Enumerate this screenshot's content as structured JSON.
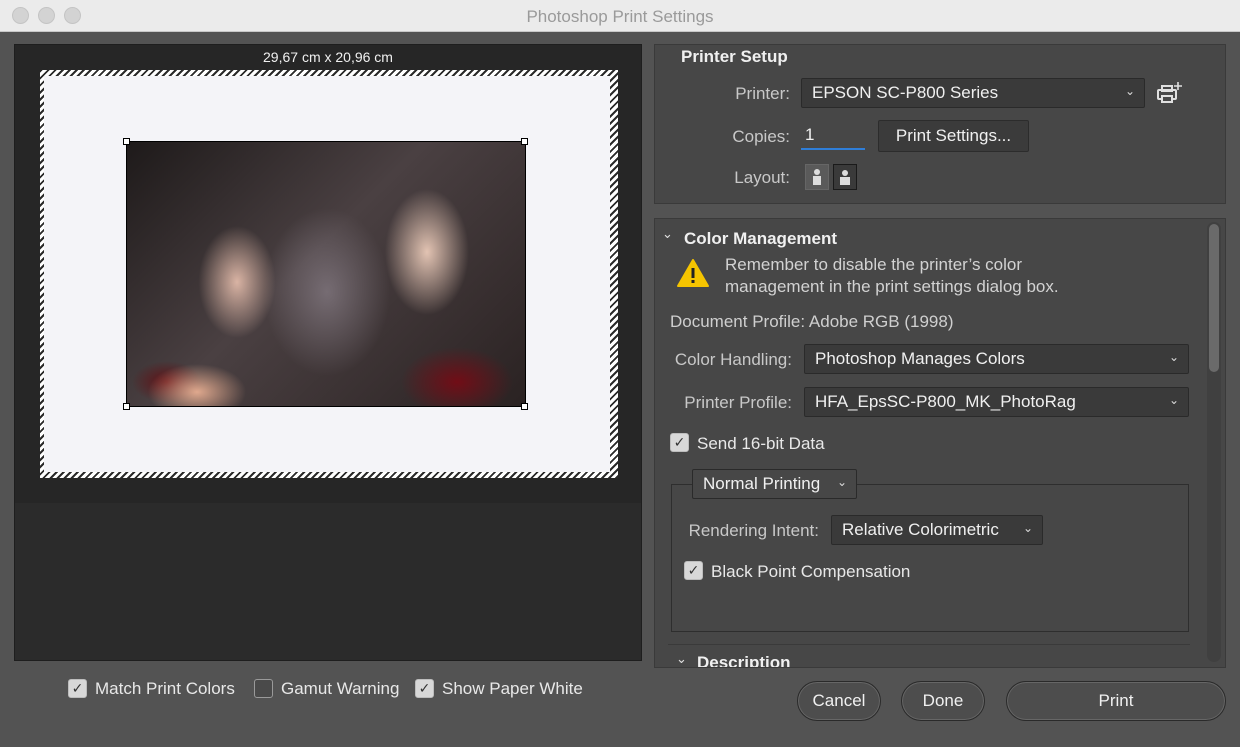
{
  "window": {
    "title": "Photoshop Print Settings"
  },
  "preview": {
    "paper_size": "29,67 cm x 20,96 cm",
    "options": [
      {
        "label": "Match Print Colors",
        "checked": true
      },
      {
        "label": "Gamut Warning",
        "checked": false
      },
      {
        "label": "Show Paper White",
        "checked": true
      }
    ]
  },
  "printer_setup": {
    "heading": "Printer Setup",
    "printer_label": "Printer:",
    "printer_value": "EPSON SC-P800 Series",
    "copies_label": "Copies:",
    "copies_value": "1",
    "print_settings_button": "Print Settings...",
    "layout_label": "Layout:",
    "layout_options": [
      "portrait-icon",
      "landscape-icon"
    ],
    "layout_selected": "landscape-icon"
  },
  "color_management": {
    "heading": "Color Management",
    "warning_text_line1": "Remember to disable the printer’s color",
    "warning_text_line2": "management in the print settings dialog box.",
    "document_profile": "Document Profile: Adobe RGB (1998)",
    "color_handling_label": "Color Handling:",
    "color_handling_value": "Photoshop Manages Colors",
    "printer_profile_label": "Printer Profile:",
    "printer_profile_value": "HFA_EpsSC-P800_MK_PhotoRag",
    "send_16bit_label": "Send 16-bit Data",
    "send_16bit_checked": true,
    "print_mode_value": "Normal Printing",
    "rendering_intent_label": "Rendering Intent:",
    "rendering_intent_value": "Relative Colorimetric",
    "bpc_label": "Black Point Compensation",
    "bpc_checked": true
  },
  "description": {
    "heading": "Description"
  },
  "footer": {
    "cancel_label": "Cancel",
    "done_label": "Done",
    "print_label": "Print"
  },
  "colors": {
    "background": "#535353",
    "panel": "#474747",
    "accent": "#2f7ed8",
    "warning": "#f5c400"
  }
}
